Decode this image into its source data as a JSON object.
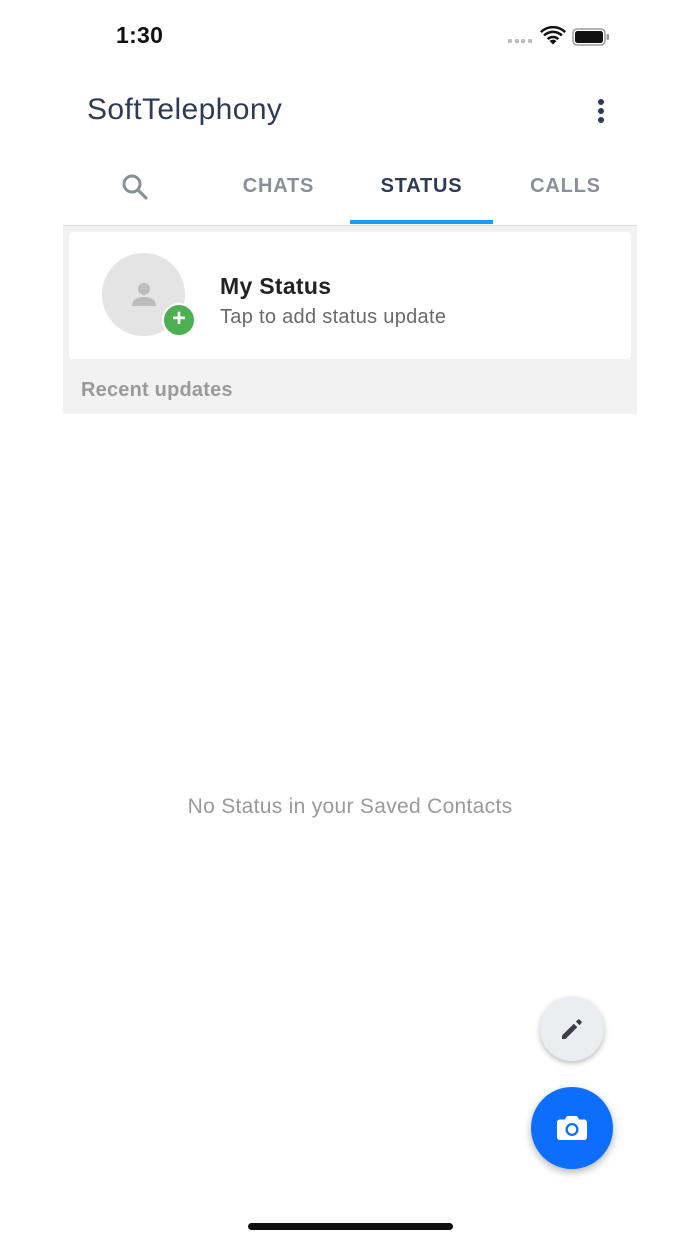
{
  "status_bar": {
    "time": "1:30"
  },
  "header": {
    "title": "SoftTelephony",
    "menu_icon": "more-vertical-icon"
  },
  "tabs": [
    {
      "label": "",
      "icon": "search-icon",
      "active": false
    },
    {
      "label": "CHATS",
      "active": false
    },
    {
      "label": "STATUS",
      "active": true
    },
    {
      "label": "CALLS",
      "active": false
    }
  ],
  "my_status": {
    "title": "My Status",
    "subtitle": "Tap to add status update",
    "badge": "+"
  },
  "recent_updates": {
    "header": "Recent updates",
    "empty_message": "No Status in your Saved Contacts"
  },
  "fabs": {
    "edit_icon": "pencil-icon",
    "camera_icon": "camera-icon"
  },
  "colors": {
    "accent": "#1d9bf0",
    "title": "#2f3b55",
    "fab_primary": "#0d6efd",
    "badge_green": "#4caf50"
  }
}
